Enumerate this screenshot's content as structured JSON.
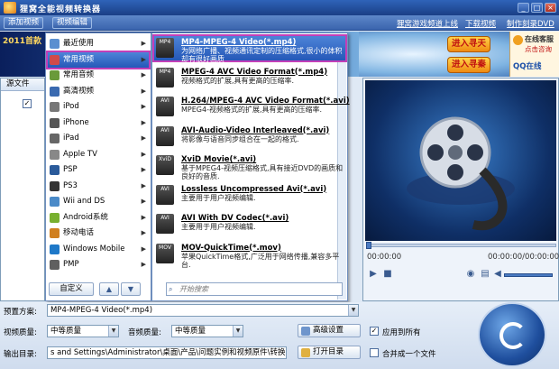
{
  "window": {
    "title": "狸窝全能视频转换器"
  },
  "toolbar": {
    "add_video": "添加视频",
    "video_edit": "视频编辑",
    "links": [
      "狸窝游戏频道上线",
      "下载视频",
      "制作刻录DVD"
    ]
  },
  "banner": {
    "left_text": "2011首款",
    "promo_top": "进入寻天",
    "promo_bottom": "进入寻秦",
    "cs_top": "在线客服",
    "cs_mid": "点击咨询",
    "cs_qq": "QQ在线"
  },
  "source_panel": {
    "header": "源文件"
  },
  "menu": {
    "items": [
      {
        "label": "最近使用",
        "icon": "clock-icon",
        "arrow": true
      },
      {
        "label": "常用视频",
        "icon": "film-icon",
        "arrow": true,
        "selected": true
      },
      {
        "label": "常用音频",
        "icon": "music-icon",
        "arrow": true
      },
      {
        "label": "高清视频",
        "icon": "hd-icon",
        "arrow": true
      },
      {
        "label": "iPod",
        "icon": "ipod-icon",
        "arrow": true
      },
      {
        "label": "iPhone",
        "icon": "iphone-icon",
        "arrow": true
      },
      {
        "label": "iPad",
        "icon": "ipad-icon",
        "arrow": true
      },
      {
        "label": "Apple TV",
        "icon": "appletv-icon",
        "arrow": true
      },
      {
        "label": "PSP",
        "icon": "psp-icon",
        "arrow": true
      },
      {
        "label": "PS3",
        "icon": "ps3-icon",
        "arrow": true
      },
      {
        "label": "Wii and DS",
        "icon": "wii-icon",
        "arrow": true
      },
      {
        "label": "Android系统",
        "icon": "android-icon",
        "arrow": true
      },
      {
        "label": "移动电话",
        "icon": "phone-icon",
        "arrow": true
      },
      {
        "label": "Windows Mobile",
        "icon": "windows-icon",
        "arrow": true
      },
      {
        "label": "PMP",
        "icon": "pmp-icon",
        "arrow": true
      }
    ],
    "custom_button": "自定义",
    "search_placeholder": "开始搜索"
  },
  "formats": [
    {
      "tag": "MP4",
      "name": "MP4-MPEG-4 Video(*.mp4)",
      "desc": "为网络广播、视频通讯定制的压缩格式,很小的体积却有很好画质",
      "selected": true
    },
    {
      "tag": "MP4",
      "name": "MPEG-4 AVC Video Format(*.mp4)",
      "desc": "视频格式的扩展,具有更高的压缩率."
    },
    {
      "tag": "AVI",
      "name": "H.264/MPEG-4 AVC Video Format(*.avi)",
      "desc": "MPEG4-视频格式的扩展,具有更高的压缩率."
    },
    {
      "tag": "AVI",
      "name": "AVI-Audio-Video Interleaved(*.avi)",
      "desc": "将影像与语音同步组合在一起的格式."
    },
    {
      "tag": "XviD",
      "name": "XviD Movie(*.avi)",
      "desc": "基于MPEG4-视频压缩格式,具有接近DVD的画质和良好的音质."
    },
    {
      "tag": "AVI",
      "name": "Lossless Uncompressed Avi(*.avi)",
      "desc": "主要用于用户视频编辑."
    },
    {
      "tag": "AVI",
      "name": "AVI With DV Codec(*.avi)",
      "desc": "主要用于用户视频编辑."
    },
    {
      "tag": "MOV",
      "name": "MOV-QuickTime(*.mov)",
      "desc": "苹果QuickTime格式,广泛用于网络传播,兼容多平台."
    }
  ],
  "preview": {
    "time_current": "00:00:00",
    "time_total": "00:00:00/00:00:00",
    "progress": 0
  },
  "bottom": {
    "preset_label": "预置方案:",
    "preset_value": "MP4-MPEG-4 Video(*.mp4)",
    "video_quality_label": "视频质量:",
    "video_quality_value": "中等质量",
    "audio_quality_label": "音频质量:",
    "audio_quality_value": "中等质量",
    "advanced_settings": "高级设置",
    "apply_all_label": "应用到所有",
    "apply_all_checked": true,
    "output_label": "输出目录:",
    "output_value": "s and Settings\\Administrator\\桌面\\产品\\问题实例和视频原件\\转换",
    "open_dir": "打开目录",
    "merge_label": "合并成一个文件",
    "merge_checked": false
  },
  "colors": {
    "accent": "#2558b8",
    "highlight_outline": "#c23fb8",
    "title_bar": "#1a3f86"
  }
}
